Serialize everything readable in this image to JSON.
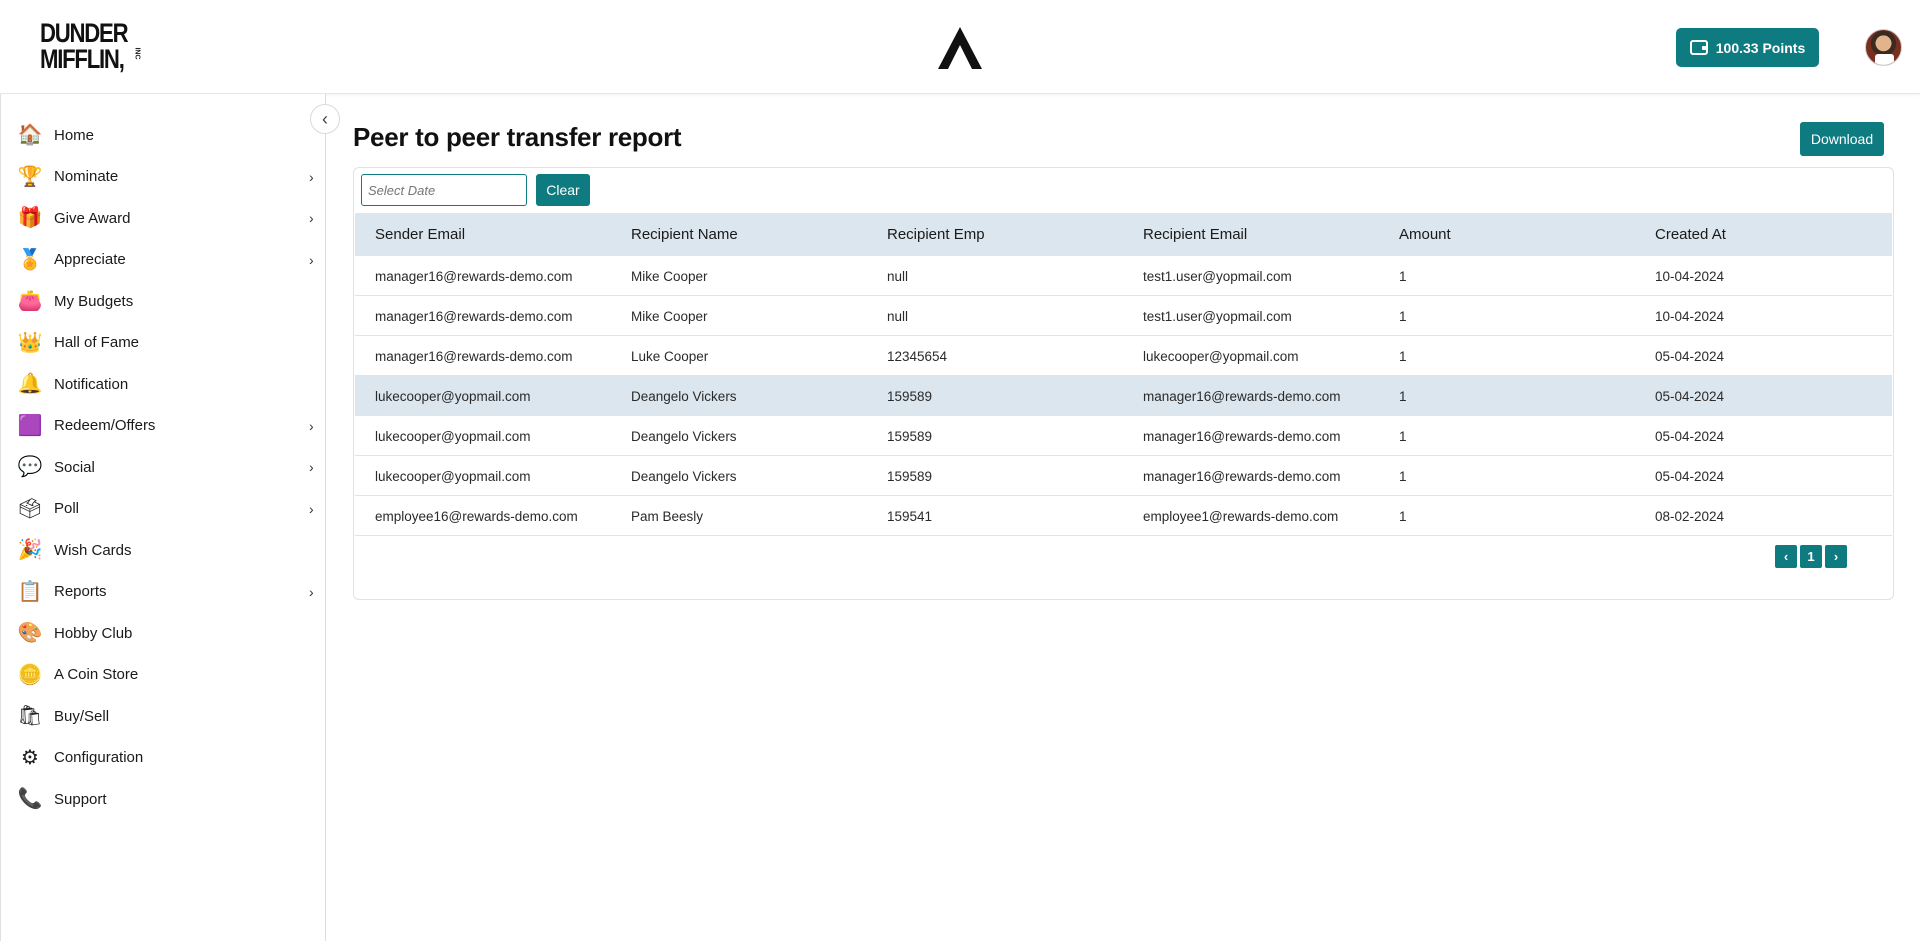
{
  "header": {
    "logo_line1": "DUNDER",
    "logo_line2": "MIFFLIN,",
    "logo_inc": "INC",
    "points_label": "100.33  Points"
  },
  "sidebar": {
    "items": [
      {
        "label": "Home",
        "icon": "home-icon",
        "has_submenu": false
      },
      {
        "label": "Nominate",
        "icon": "trophy-icon",
        "has_submenu": true
      },
      {
        "label": "Give Award",
        "icon": "gift-icon",
        "has_submenu": true
      },
      {
        "label": "Appreciate",
        "icon": "medal-icon",
        "has_submenu": true
      },
      {
        "label": "My Budgets",
        "icon": "wallet-icon",
        "has_submenu": false
      },
      {
        "label": "Hall of Fame",
        "icon": "crown-icon",
        "has_submenu": false
      },
      {
        "label": "Notification",
        "icon": "bell-icon",
        "has_submenu": false
      },
      {
        "label": "Redeem/Offers",
        "icon": "redeem-icon",
        "has_submenu": true
      },
      {
        "label": "Social",
        "icon": "social-icon",
        "has_submenu": true
      },
      {
        "label": "Poll",
        "icon": "poll-icon",
        "has_submenu": true
      },
      {
        "label": "Wish Cards",
        "icon": "party-popper-icon",
        "has_submenu": false
      },
      {
        "label": "Reports",
        "icon": "clipboard-icon",
        "has_submenu": true
      },
      {
        "label": "Hobby Club",
        "icon": "hobby-icon",
        "has_submenu": false
      },
      {
        "label": "A Coin Store",
        "icon": "coin-icon",
        "has_submenu": false
      },
      {
        "label": "Buy/Sell",
        "icon": "shopping-bags-icon",
        "has_submenu": false
      },
      {
        "label": "Configuration",
        "icon": "configuration-icon",
        "has_submenu": false
      },
      {
        "label": "Support",
        "icon": "phone-icon",
        "has_submenu": false
      }
    ]
  },
  "main": {
    "title": "Peer to peer transfer report",
    "download_label": "Download",
    "date_placeholder": "Select Date",
    "clear_label": "Clear",
    "columns": [
      "Sender Email",
      "Recipient Name",
      "Recipient Emp",
      "Recipient Email",
      "Amount",
      "Created At"
    ],
    "rows": [
      [
        "manager16@rewards-demo.com",
        "Mike Cooper",
        "null",
        "test1.user@yopmail.com",
        "1",
        "10-04-2024"
      ],
      [
        "manager16@rewards-demo.com",
        "Mike Cooper",
        "null",
        "test1.user@yopmail.com",
        "1",
        "10-04-2024"
      ],
      [
        "manager16@rewards-demo.com",
        "Luke Cooper",
        "12345654",
        "lukecooper@yopmail.com",
        "1",
        "05-04-2024"
      ],
      [
        "lukecooper@yopmail.com",
        "Deangelo Vickers",
        "159589",
        "manager16@rewards-demo.com",
        "1",
        "05-04-2024"
      ],
      [
        "lukecooper@yopmail.com",
        "Deangelo Vickers",
        "159589",
        "manager16@rewards-demo.com",
        "1",
        "05-04-2024"
      ],
      [
        "lukecooper@yopmail.com",
        "Deangelo Vickers",
        "159589",
        "manager16@rewards-demo.com",
        "1",
        "05-04-2024"
      ],
      [
        "employee16@rewards-demo.com",
        "Pam Beesly",
        "159541",
        "employee1@rewards-demo.com",
        "1",
        "08-02-2024"
      ]
    ],
    "highlighted_row": 3,
    "pagination": {
      "prev": "‹",
      "current": "1",
      "next": "›"
    }
  },
  "colors": {
    "accent": "#0d7b7f",
    "table_header": "#dce6ee"
  }
}
